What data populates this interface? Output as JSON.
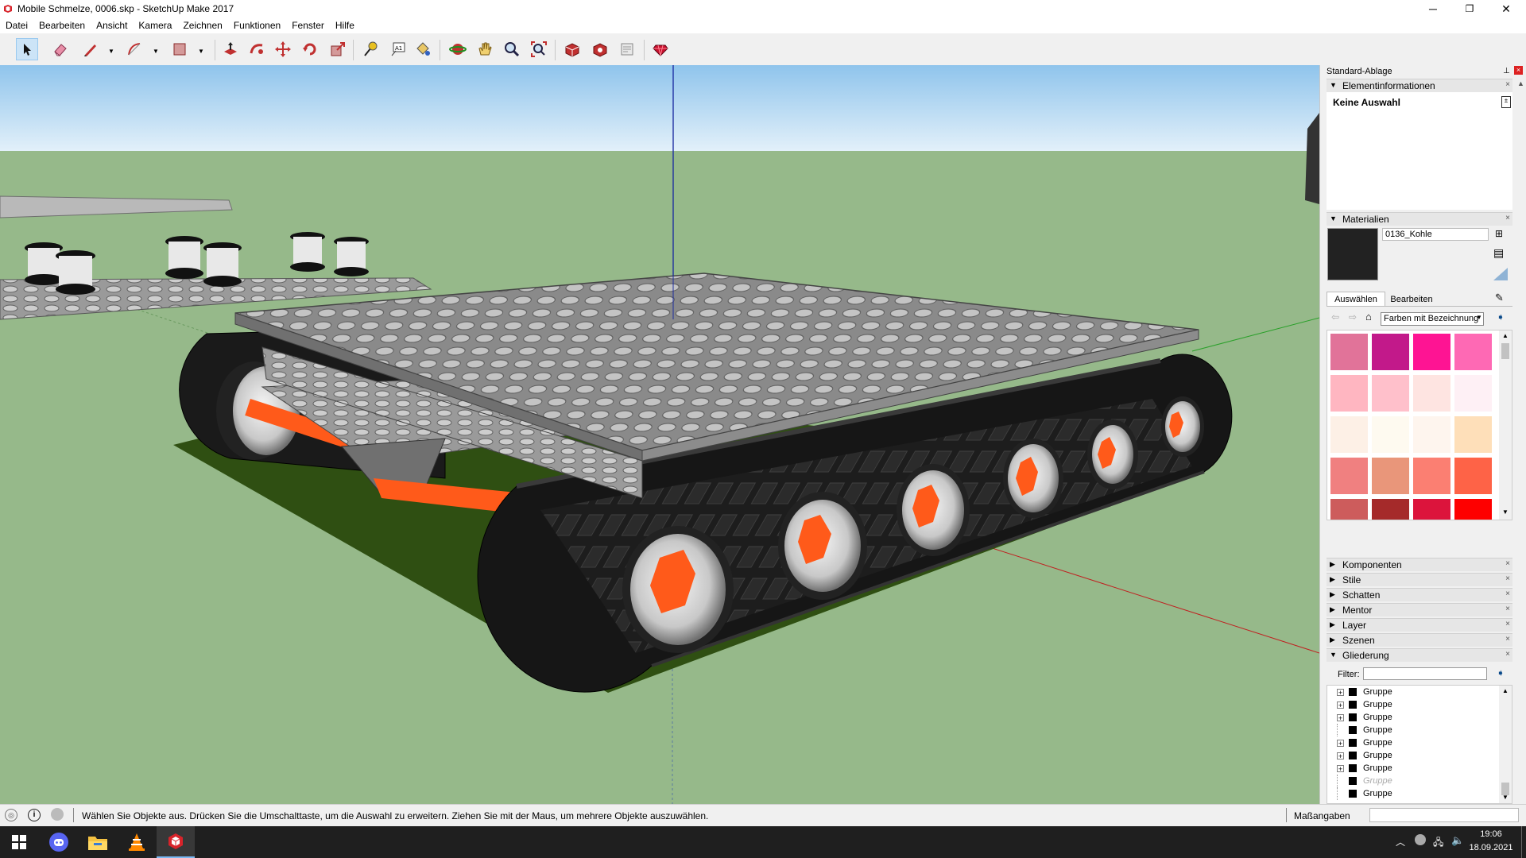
{
  "window": {
    "title": "Mobile Schmelze, 0006.skp - SketchUp Make 2017",
    "minimize": "─",
    "restore": "❐",
    "close": "✕"
  },
  "menu": [
    "Datei",
    "Bearbeiten",
    "Ansicht",
    "Kamera",
    "Zeichnen",
    "Funktionen",
    "Fenster",
    "Hilfe"
  ],
  "toolbar": {
    "tools": [
      "select-tool",
      "eraser-tool",
      "line-tool",
      "arc-tool",
      "rectangle-tool",
      "push-pull-tool",
      "follow-me-tool",
      "move-tool",
      "rotate-tool",
      "scale-tool",
      "tape-measure-tool",
      "text-tool",
      "paint-bucket-tool",
      "orbit-tool",
      "pan-tool",
      "zoom-tool",
      "zoom-extents-tool",
      "warehouse-tool",
      "extension-warehouse-tool",
      "layout-tool",
      "ruby-tool"
    ],
    "active": "select-tool",
    "text_tool_label": "A1"
  },
  "panel": {
    "tray_title": "Standard-Ablage",
    "entity_info": {
      "title": "Elementinformationen",
      "selection": "Keine Auswahl"
    },
    "materials": {
      "title": "Materialien",
      "current_name": "0136_Kohle",
      "current_color": "#222222",
      "tab_select": "Auswählen",
      "tab_edit": "Bearbeiten",
      "library": "Farben mit Bezeichnung",
      "swatches": [
        "#e17399",
        "#c2198a",
        "#fe1493",
        "#fe69b4",
        "#ffb6c1",
        "#ffc0cb",
        "#fee4e1",
        "#fef0f5",
        "#fdf0e6",
        "#fefaf0",
        "#fef5ee",
        "#fedfb9",
        "#f08080",
        "#e9967a",
        "#fb7f72",
        "#fe6347",
        "#cd5c5c",
        "#a52a2a",
        "#dc143c",
        "#fe0000",
        "#8b0000",
        "#800000",
        "#b22222",
        "#ff4500"
      ]
    },
    "collapsed_sections": [
      "Komponenten",
      "Stile",
      "Schatten",
      "Mentor",
      "Layer",
      "Szenen"
    ],
    "outliner": {
      "title": "Gliederung",
      "filter_label": "Filter:",
      "filter_value": "",
      "items": [
        {
          "label": "Gruppe",
          "expandable": true,
          "hidden": false
        },
        {
          "label": "Gruppe",
          "expandable": true,
          "hidden": false
        },
        {
          "label": "Gruppe",
          "expandable": true,
          "hidden": false
        },
        {
          "label": "Gruppe",
          "expandable": false,
          "hidden": false
        },
        {
          "label": "Gruppe",
          "expandable": true,
          "hidden": false
        },
        {
          "label": "Gruppe",
          "expandable": true,
          "hidden": false
        },
        {
          "label": "Gruppe",
          "expandable": true,
          "hidden": false
        },
        {
          "label": "Gruppe",
          "expandable": false,
          "hidden": true
        },
        {
          "label": "Gruppe",
          "expandable": false,
          "hidden": false
        }
      ]
    }
  },
  "statusbar": {
    "message": "Wählen Sie Objekte aus. Drücken Sie die Umschalttaste, um die Auswahl zu erweitern. Ziehen Sie mit der Maus, um mehrere Objekte auszuwählen.",
    "measurements_label": "Maßangaben",
    "measurements_value": ""
  },
  "taskbar": {
    "apps": [
      "start-icon",
      "discord-icon",
      "file-explorer-icon",
      "vlc-icon",
      "sketchup-icon"
    ],
    "time": "19:06",
    "date": "18.09.2021"
  },
  "colors": {
    "sky_top": "#8fc4ec",
    "sky_bottom": "#e4f1fa",
    "ground": "#96b98a",
    "accent_orange": "#ff5a1a",
    "selection_blue": "#cce4f7"
  }
}
